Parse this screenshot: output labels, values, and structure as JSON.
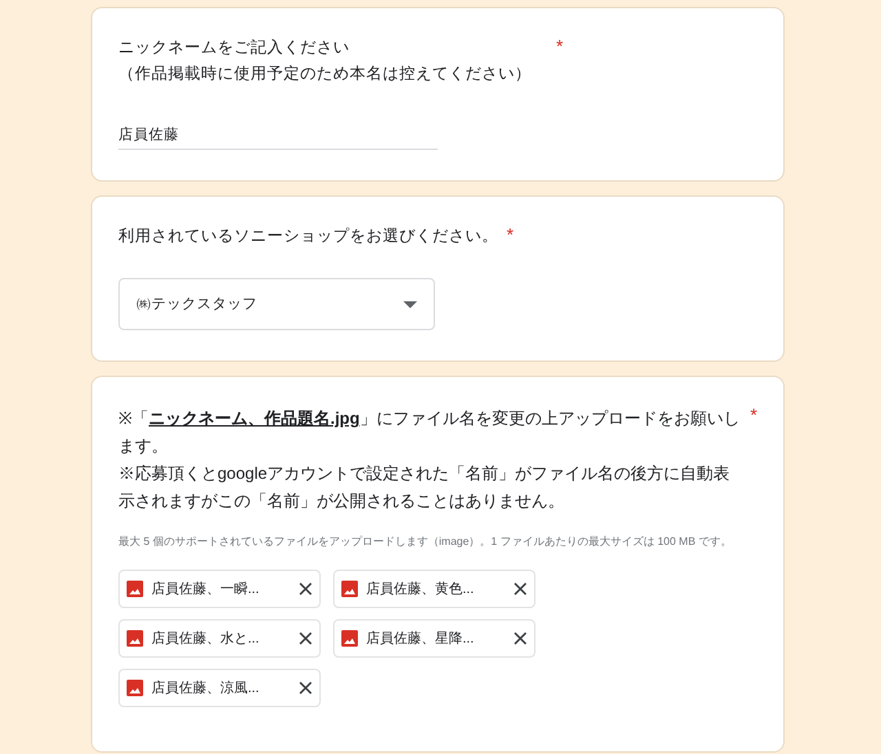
{
  "questions": [
    {
      "kind": "text",
      "title_lines": [
        "ニックネームをご記入ください",
        "（作品掲載時に使用予定のため本名は控えてください）"
      ],
      "required_mark": "*",
      "value": "店員佐藤"
    },
    {
      "kind": "dropdown",
      "title_lines": [
        "利用されているソニーショップをお選びください。"
      ],
      "required_mark": "*",
      "value": "㈱テックスタッフ"
    },
    {
      "kind": "upload",
      "title_lines": [
        "※「**ニックネーム、作品題名.jpg**」にファイル名を変更の上アップロードをお願いします。",
        "※応募頂くとgoogleアカウントで設定された「名前」がファイル名の後方に自動表示されますがこの「名前」が公開されることはありません。"
      ],
      "required_mark": "*",
      "hint": "最大 5 個のサポートされているファイルをアップロードします（image）。1 ファイルあたりの最大サイズは 100 MB です。",
      "files": [
        {
          "name": "店員佐藤、一瞬..."
        },
        {
          "name": "店員佐藤、黄色..."
        },
        {
          "name": "店員佐藤、水と..."
        },
        {
          "name": "店員佐藤、星降..."
        },
        {
          "name": "店員佐藤、涼風..."
        }
      ]
    }
  ]
}
